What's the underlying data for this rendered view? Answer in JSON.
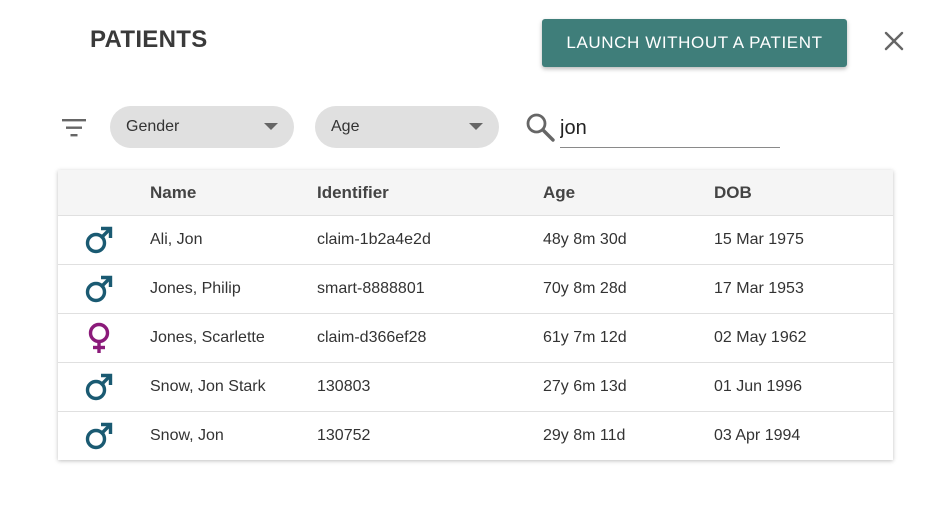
{
  "header": {
    "title": "PATIENTS",
    "launch_button_label": "LAUNCH WITHOUT A PATIENT",
    "close_icon": "close-icon"
  },
  "filters": {
    "filter_icon": "filter-list-icon",
    "gender": {
      "label": "Gender"
    },
    "age": {
      "label": "Age"
    },
    "search": {
      "value": "jon",
      "placeholder": "",
      "icon": "search-icon"
    }
  },
  "table": {
    "columns": [
      "",
      "Name",
      "Identifier",
      "Age",
      "DOB"
    ],
    "rows": [
      {
        "gender": "male",
        "name": "Ali, Jon",
        "identifier": "claim-1b2a4e2d",
        "age": "48y 8m 30d",
        "dob": "15 Mar 1975"
      },
      {
        "gender": "male",
        "name": "Jones, Philip",
        "identifier": "smart-8888801",
        "age": "70y 8m 28d",
        "dob": "17 Mar 1953"
      },
      {
        "gender": "female",
        "name": "Jones, Scarlette",
        "identifier": "claim-d366ef28",
        "age": "61y 7m 12d",
        "dob": "02 May 1962"
      },
      {
        "gender": "male",
        "name": "Snow, Jon Stark",
        "identifier": "130803",
        "age": "27y 6m 13d",
        "dob": "01 Jun 1996"
      },
      {
        "gender": "male",
        "name": "Snow, Jon",
        "identifier": "130752",
        "age": "29y 8m 11d",
        "dob": "03 Apr 1994"
      }
    ]
  },
  "colors": {
    "accent": "#3f7e7a",
    "male": "#1a5a72",
    "female": "#8b1a7a"
  }
}
